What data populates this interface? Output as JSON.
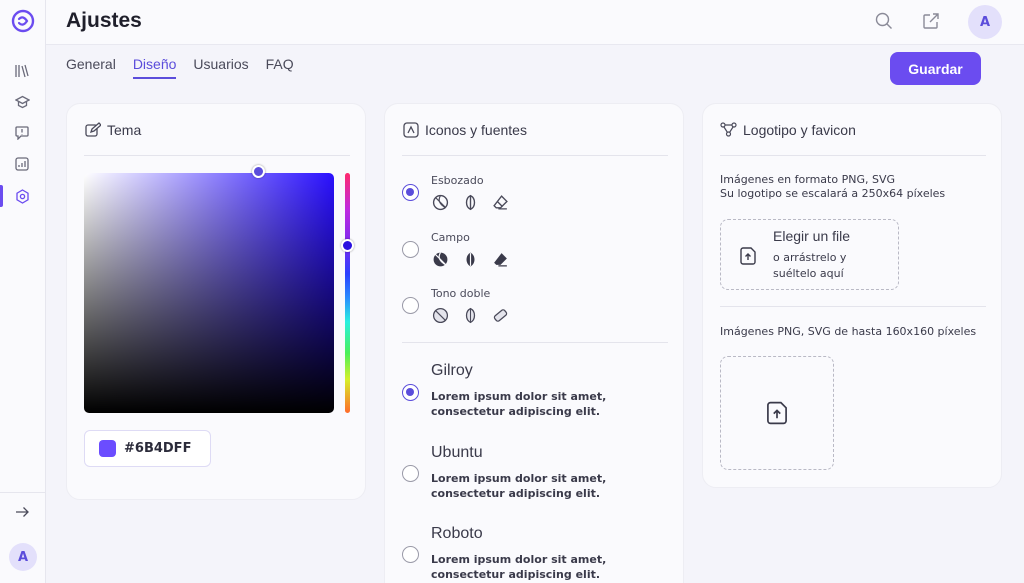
{
  "app": {
    "title": "Ajustes"
  },
  "sidebar": {
    "avatar_initial": "A"
  },
  "header": {
    "avatar_initial": "A"
  },
  "tabs": [
    {
      "label": "General",
      "active": false
    },
    {
      "label": "Diseño",
      "active": true
    },
    {
      "label": "Usuarios",
      "active": false
    },
    {
      "label": "FAQ",
      "active": false
    }
  ],
  "toolbar": {
    "save_label": "Guardar"
  },
  "tema": {
    "title": "Tema",
    "hex_value": "#6B4DFF",
    "color": "#6B4DFF"
  },
  "icons_fonts": {
    "title": "Iconos y fuentes",
    "icon_styles": [
      {
        "label": "Esbozado",
        "checked": true
      },
      {
        "label": "Campo",
        "checked": false
      },
      {
        "label": "Tono doble",
        "checked": false
      }
    ],
    "fonts": [
      {
        "name": "Gilroy",
        "desc": "Lorem ipsum dolor sit amet, consectetur adipiscing elit.",
        "checked": true
      },
      {
        "name": "Ubuntu",
        "desc": "Lorem ipsum dolor sit amet, consectetur adipiscing elit.",
        "checked": false
      },
      {
        "name": "Roboto",
        "desc": "Lorem ipsum dolor sit amet, consectetur adipiscing elit.",
        "checked": false
      }
    ]
  },
  "logo": {
    "title": "Logotipo y favicon",
    "logo_info_line1": "Imágenes en formato PNG, SVG",
    "logo_info_line2": "Su logotipo se escalará a 250x64 píxeles",
    "drop_title": "Elegir un file",
    "drop_sub_line1": "o arrástrelo y",
    "drop_sub_line2": "suéltelo aquí",
    "favicon_info": "Imágenes PNG, SVG de hasta 160x160 píxeles"
  },
  "colors": {
    "accent": "#6b4cf0",
    "accent_text": "#5b4ddb"
  }
}
